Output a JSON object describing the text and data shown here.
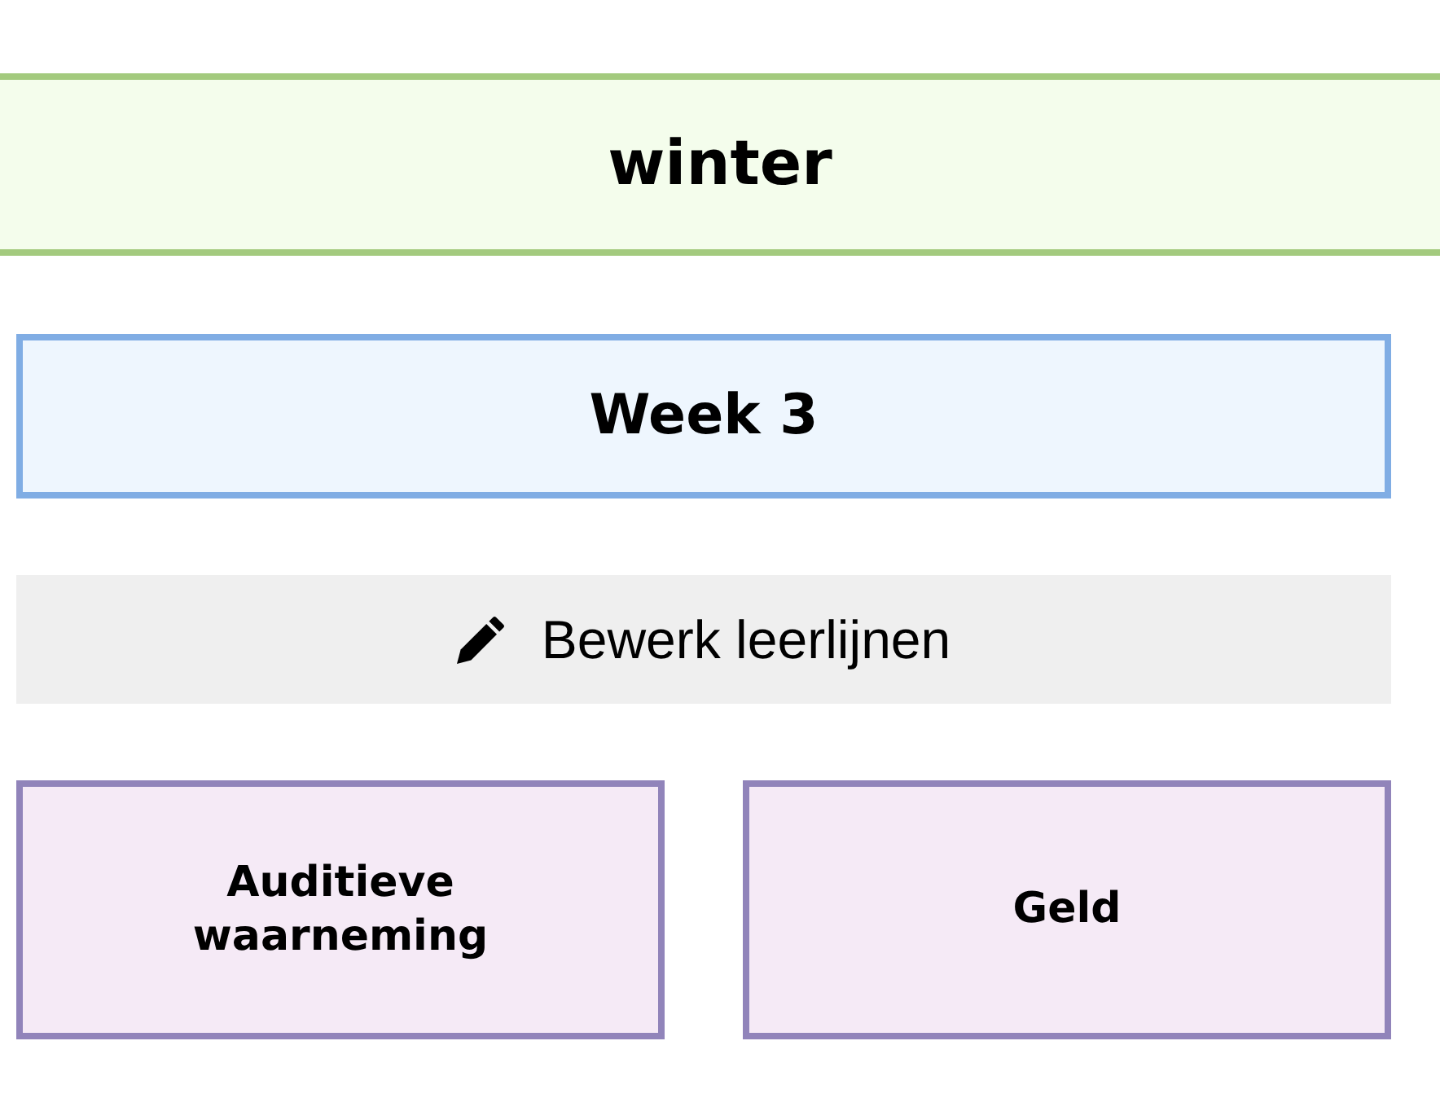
{
  "season": {
    "title": "winter"
  },
  "week": {
    "title": "Week 3"
  },
  "edit_button": {
    "label": "Bewerk leerlijnen"
  },
  "learning_lines": [
    {
      "title": "Auditieve waarneming"
    },
    {
      "title": "Geld"
    }
  ]
}
